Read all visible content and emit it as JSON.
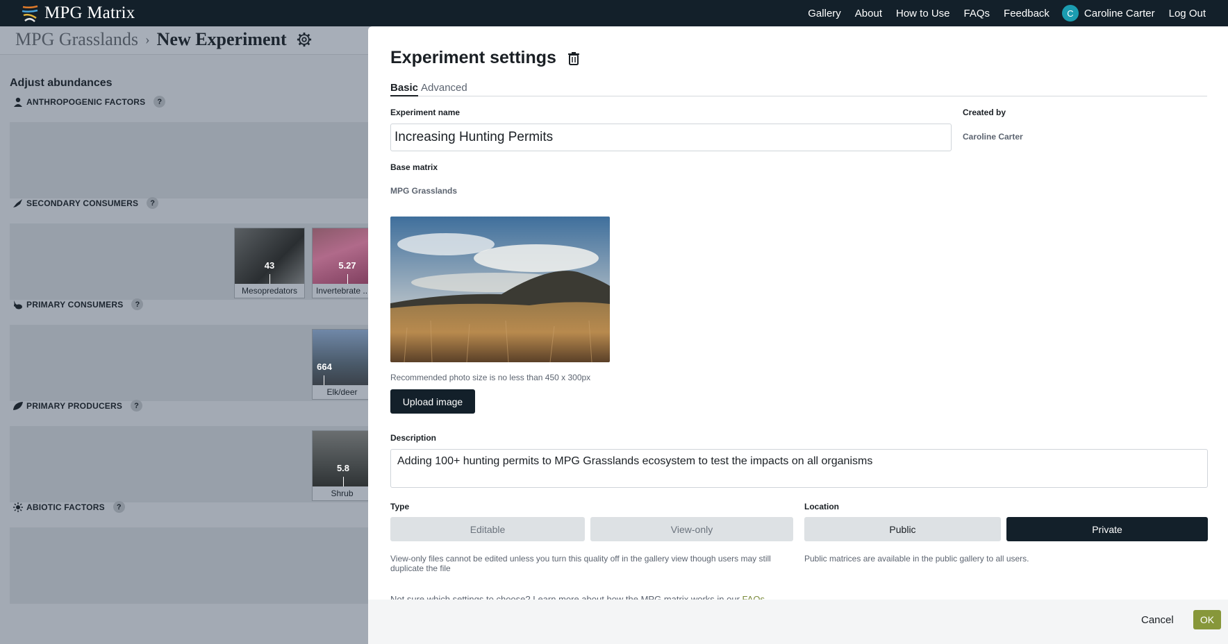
{
  "topnav": {
    "logo_text": "MPG Matrix",
    "links": [
      "Gallery",
      "About",
      "How to Use",
      "FAQs",
      "Feedback"
    ],
    "user_initial": "C",
    "user_name": "Caroline Carter",
    "logout": "Log Out"
  },
  "background": {
    "breadcrumb_root": "MPG Grasslands",
    "breadcrumb_current": "New Experiment",
    "panel_title": "Adjust abundances",
    "categories": [
      {
        "label": "ANTHROPOGENIC FACTORS",
        "icon": "person-icon"
      },
      {
        "label": "SECONDARY CONSUMERS",
        "icon": "bird-icon"
      },
      {
        "label": "PRIMARY CONSUMERS",
        "icon": "rabbit-icon"
      },
      {
        "label": "PRIMARY PRODUCERS",
        "icon": "leaf-icon"
      },
      {
        "label": "ABIOTIC FACTORS",
        "icon": "sun-icon"
      }
    ],
    "help_mark": "?",
    "cards": [
      {
        "label": "Mesopredators",
        "value": "43"
      },
      {
        "label": "Invertebrate ...",
        "value": "5.27"
      },
      {
        "label": "Elk/deer",
        "value": "664"
      },
      {
        "label": "Shrub",
        "value": "5.8"
      }
    ]
  },
  "modal": {
    "title": "Experiment settings",
    "tabs": [
      "Basic",
      "Advanced"
    ],
    "active_tab": "Basic",
    "experiment_name_label": "Experiment name",
    "experiment_name_value": "Increasing Hunting Permits",
    "created_by_label": "Created by",
    "created_by_value": "Caroline Carter",
    "base_matrix_label": "Base matrix",
    "base_matrix_value": "MPG Grasslands",
    "photo_hint": "Recommended photo size is no less than 450 x 300px",
    "upload_button": "Upload image",
    "description_label": "Description",
    "description_value": "Adding 100+ hunting permits to MPG Grasslands ecosystem to test the impacts on all organisms",
    "type_label": "Type",
    "type_options": [
      "Editable",
      "View-only"
    ],
    "type_hint": "View-only files cannot be edited unless you turn this quality off in the gallery view though users may still duplicate the file",
    "location_label": "Location",
    "location_options": [
      "Public",
      "Private"
    ],
    "location_selected": "Private",
    "location_hint": "Public matrices are available in the public gallery to all users.",
    "cta_text": "Not sure which settings to choose? Learn more about how the MPG matrix works in our ",
    "cta_link": "FAQs",
    "cancel_button": "Cancel",
    "ok_button": "OK"
  },
  "colors": {
    "nav_bg": "#13202a",
    "accent_ok": "#87973a",
    "avatar": "#1b9cb0",
    "overlay_bg": "#a3aab4"
  }
}
